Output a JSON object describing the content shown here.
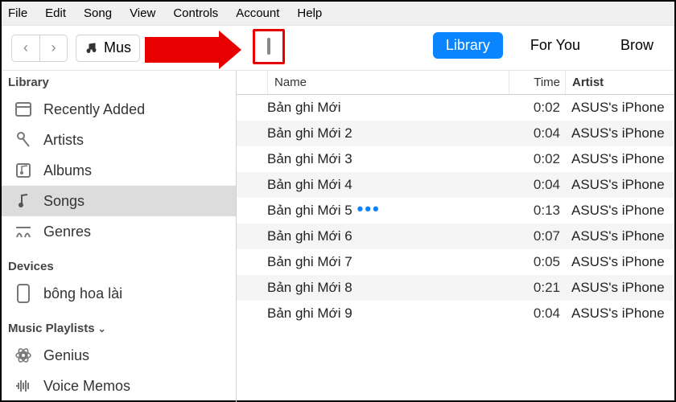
{
  "menubar": [
    "File",
    "Edit",
    "Song",
    "View",
    "Controls",
    "Account",
    "Help"
  ],
  "toolbar": {
    "back": "‹",
    "fwd": "›",
    "media_label": "Mus",
    "tabs": {
      "library": "Library",
      "for_you": "For You",
      "browse": "Brow"
    }
  },
  "sidebar": {
    "library_header": "Library",
    "library_items": [
      {
        "icon": "recently-added-icon",
        "label": "Recently Added"
      },
      {
        "icon": "microphone-icon",
        "label": "Artists"
      },
      {
        "icon": "album-icon",
        "label": "Albums"
      },
      {
        "icon": "note-icon",
        "label": "Songs",
        "selected": true
      },
      {
        "icon": "genres-icon",
        "label": "Genres"
      }
    ],
    "devices_header": "Devices",
    "devices": [
      {
        "icon": "phone-icon",
        "label": "bông hoa lài"
      }
    ],
    "playlists_header": "Music Playlists",
    "playlists": [
      {
        "icon": "genius-icon",
        "label": "Genius"
      },
      {
        "icon": "voice-memos-icon",
        "label": "Voice Memos"
      }
    ]
  },
  "table": {
    "columns": {
      "name": "Name",
      "time": "Time",
      "artist": "Artist"
    },
    "rows": [
      {
        "name": "Bản ghi Mới",
        "time": "0:02",
        "artist": "ASUS's iPhone",
        "now": false
      },
      {
        "name": "Bản ghi Mới 2",
        "time": "0:04",
        "artist": "ASUS's iPhone",
        "now": false
      },
      {
        "name": "Bản ghi Mới 3",
        "time": "0:02",
        "artist": "ASUS's iPhone",
        "now": false
      },
      {
        "name": "Bản ghi Mới 4",
        "time": "0:04",
        "artist": "ASUS's iPhone",
        "now": false
      },
      {
        "name": "Bản ghi Mới 5",
        "time": "0:13",
        "artist": "ASUS's iPhone",
        "now": true
      },
      {
        "name": "Bản ghi Mới 6",
        "time": "0:07",
        "artist": "ASUS's iPhone",
        "now": false
      },
      {
        "name": "Bản ghi Mới 7",
        "time": "0:05",
        "artist": "ASUS's iPhone",
        "now": false
      },
      {
        "name": "Bản ghi Mới 8",
        "time": "0:21",
        "artist": "ASUS's iPhone",
        "now": false
      },
      {
        "name": "Bản ghi Mới 9",
        "time": "0:04",
        "artist": "ASUS's iPhone",
        "now": false
      }
    ]
  }
}
